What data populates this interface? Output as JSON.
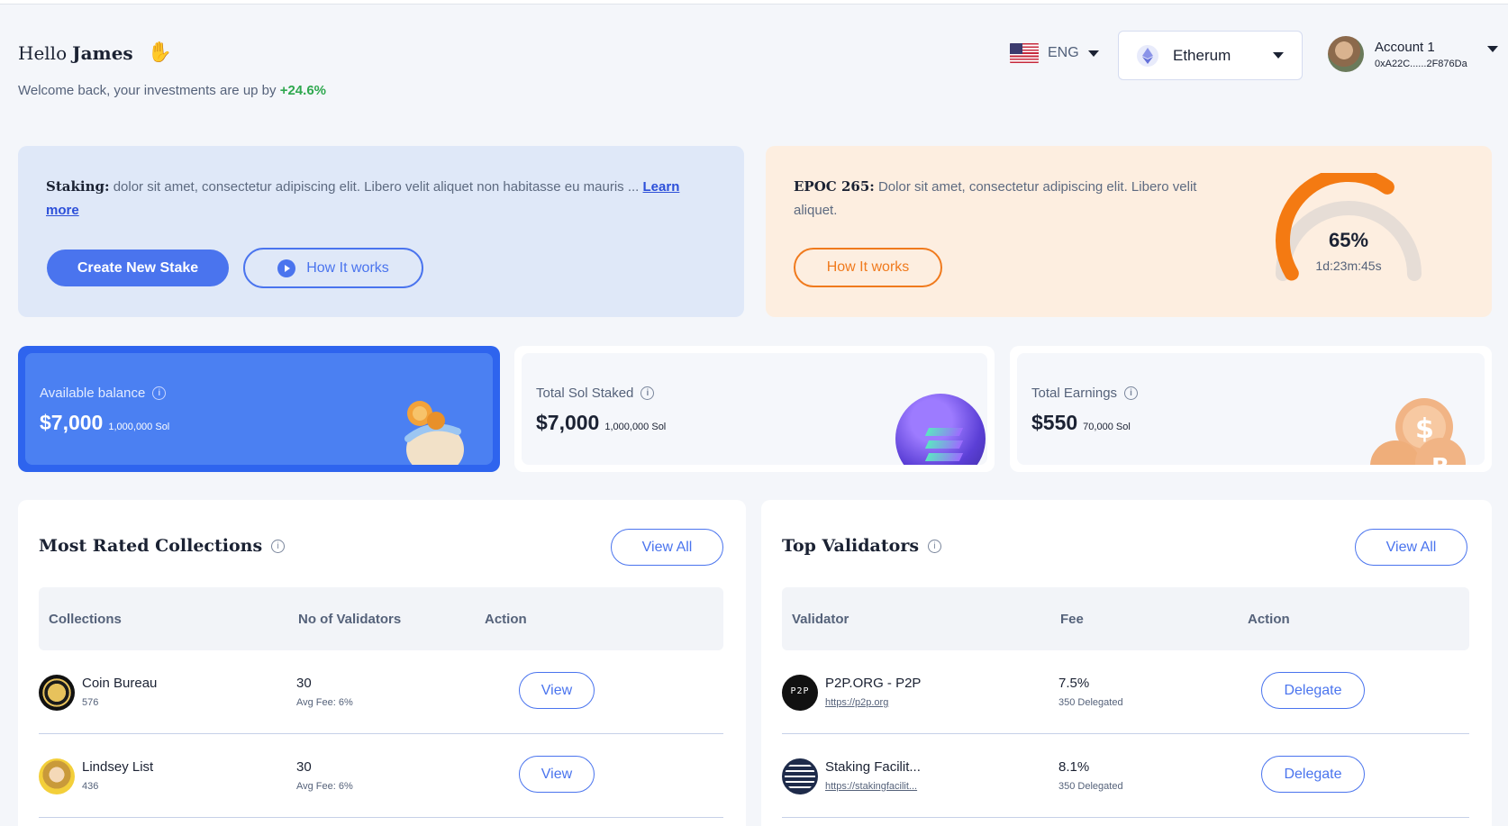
{
  "header": {
    "greeting_hello": "Hello",
    "greeting_name": "James",
    "welcome_text": "Welcome back, your investments are up by",
    "welcome_change": "+24.6%",
    "language": "ENG",
    "network": "Etherum",
    "account_name": "Account 1",
    "account_address": "0xA22C......2F876Da"
  },
  "staking_banner": {
    "title": "Staking:",
    "text": "dolor sit amet, consectetur adipiscing elit. Libero velit aliquet non habitasse eu mauris ...",
    "learn_more": "Learn more",
    "create_button": "Create New Stake",
    "how_button": "How It works"
  },
  "epoch_banner": {
    "title": "EPOC 265:",
    "text": "Dolor sit amet, consectetur adipiscing elit. Libero velit aliquet.",
    "how_button": "How It works",
    "progress_percent": 65,
    "progress_label": "65%",
    "time_left": "1d:23m:45s"
  },
  "stats": [
    {
      "label": "Available balance",
      "value": "$7,000",
      "sub": "1,000,000 Sol"
    },
    {
      "label": "Total Sol Staked",
      "value": "$7,000",
      "sub": "1,000,000 Sol"
    },
    {
      "label": "Total Earnings",
      "value": "$550",
      "sub": "70,000 Sol"
    }
  ],
  "collections": {
    "title": "Most Rated Collections",
    "view_all": "View All",
    "columns": [
      "Collections",
      "No of Validators",
      "Action"
    ],
    "rows": [
      {
        "name": "Coin Bureau",
        "sub": "576",
        "validators": "30",
        "fee": "Avg Fee: 6%",
        "action": "View"
      },
      {
        "name": "Lindsey List",
        "sub": "436",
        "validators": "30",
        "fee": "Avg Fee: 6%",
        "action": "View"
      }
    ]
  },
  "validators": {
    "title": "Top Validators",
    "view_all": "View All",
    "columns": [
      "Validator",
      "Fee",
      "Action"
    ],
    "rows": [
      {
        "name": "P2P.ORG - P2P",
        "link": "https://p2p.org",
        "fee": "7.5%",
        "delegated": "350 Delegated",
        "action": "Delegate"
      },
      {
        "name": "Staking Facilit...",
        "link": "https://stakingfacilit...",
        "fee": "8.1%",
        "delegated": "350 Delegated",
        "action": "Delegate"
      }
    ]
  },
  "colors": {
    "accent": "#4a74ee",
    "orange": "#f07a1d",
    "positive": "#2fa84f"
  }
}
